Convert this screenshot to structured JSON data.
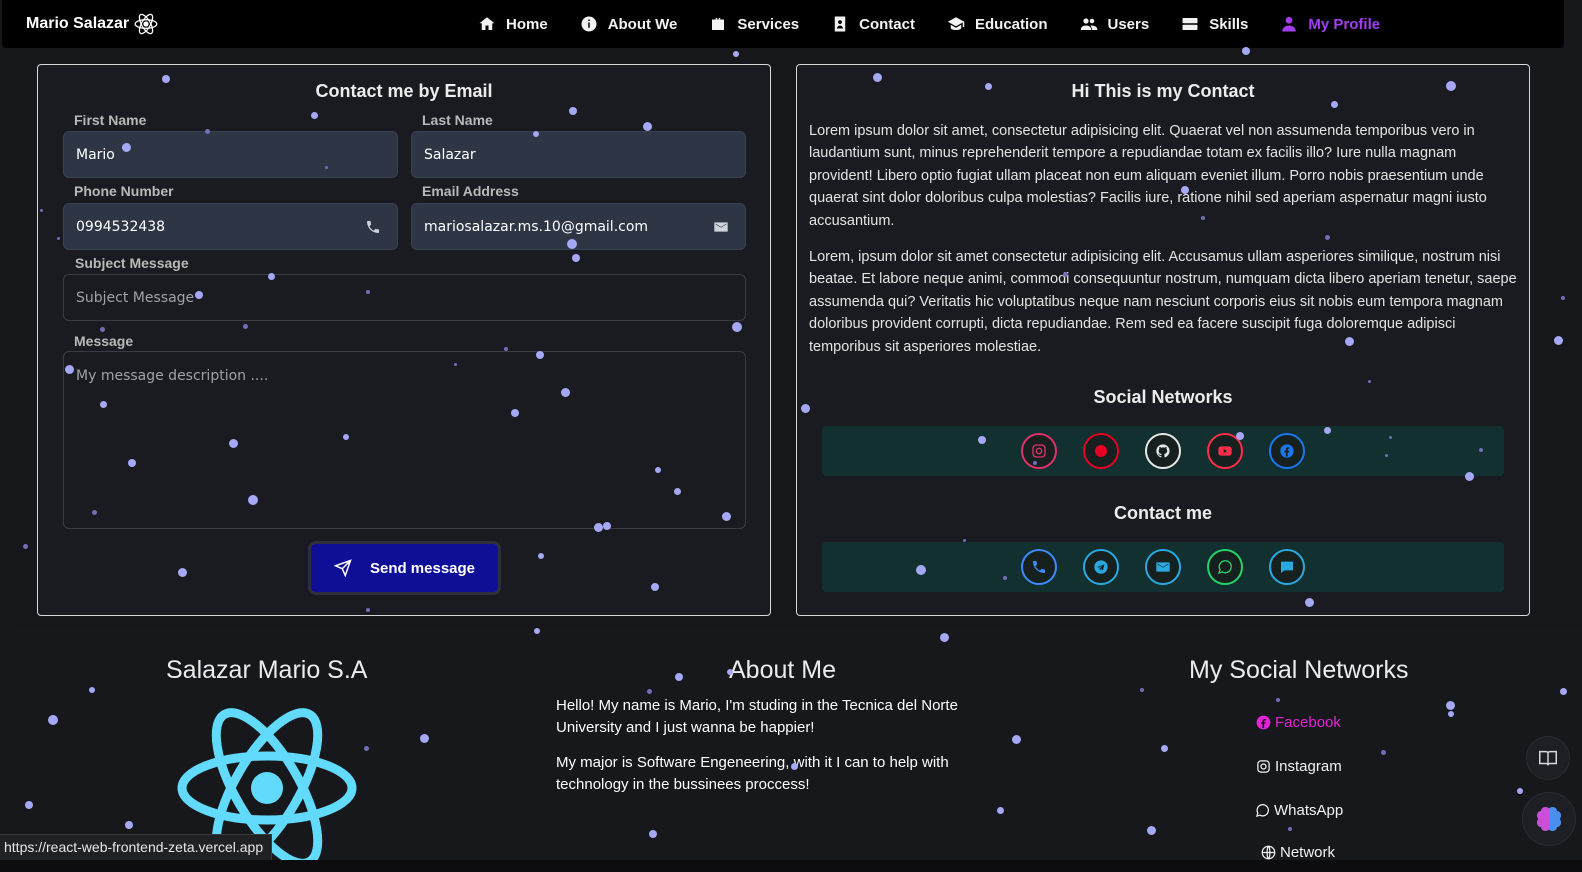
{
  "brand": {
    "name": "Mario Salazar",
    "icon": "react-atom-icon"
  },
  "nav": {
    "items": [
      {
        "label": "Home",
        "icon": "home-icon"
      },
      {
        "label": "About We",
        "icon": "info-icon"
      },
      {
        "label": "Services",
        "icon": "briefcase-icon"
      },
      {
        "label": "Contact",
        "icon": "contact-book-icon"
      },
      {
        "label": "Education",
        "icon": "graduation-cap-icon"
      },
      {
        "label": "Users",
        "icon": "users-icon"
      },
      {
        "label": "Skills",
        "icon": "server-icon"
      },
      {
        "label": "My Profile",
        "icon": "user-icon",
        "active": true
      }
    ],
    "active_color": "#a23ef0"
  },
  "contact_form": {
    "title": "Contact me by Email",
    "first_name": {
      "label": "First Name",
      "value": "Mario"
    },
    "last_name": {
      "label": "Last Name",
      "value": "Salazar"
    },
    "phone": {
      "label": "Phone Number",
      "value": "0994532438"
    },
    "email": {
      "label": "Email Address",
      "value": "mariosalazar.ms.10@gmail.com"
    },
    "subject": {
      "label": "Subject Message",
      "placeholder": "Subject Message"
    },
    "message": {
      "label": "Message",
      "placeholder": "My message description ...."
    },
    "send_label": "Send message"
  },
  "contact_info": {
    "title": "Hi This is my Contact",
    "paragraph1": "Lorem ipsum dolor sit amet, consectetur adipisicing elit. Quaerat vel non assumenda temporibus vero in laudantium sunt, minus reprehenderit tempore a repudiandae totam ex facilis illo? Iure nulla magnam provident! Libero optio fugiat ullam placeat non eum aliquam eveniet illum. Porro nobis praesentium unde quaerat sint dolor doloribus culpa molestias? Facilis iure, ratione nihil sed aperiam aspernatur magni iusto accusantium.",
    "paragraph2": "Lorem, ipsum dolor sit amet consectetur adipisicing elit. Accusamus ullam asperiores similique, nostrum nisi beatae. Et labore neque animi, commodi consequuntur nostrum, numquam dicta libero aperiam tenetur, saepe assumenda qui? Veritatis hic voluptatibus neque nam nesciunt corporis eius sit nobis eum tempora magnam doloribus provident corrupti, dicta repudiandae. Rem sed ea facere suscipit fuga doloremque adipisci temporibus sit asperiores molestiae.",
    "social_title": "Social Networks",
    "social_icons": [
      {
        "icon": "instagram-icon",
        "color": "#e1306c"
      },
      {
        "icon": "pinterest-icon",
        "color": "#e60023"
      },
      {
        "icon": "github-icon",
        "color": "#e8e8e8"
      },
      {
        "icon": "youtube-icon",
        "color": "#ff2d4a"
      },
      {
        "icon": "facebook-icon",
        "color": "#1877f2"
      }
    ],
    "contact_title": "Contact me",
    "contact_icons": [
      {
        "icon": "phone-icon",
        "color": "#3d8bfd"
      },
      {
        "icon": "telegram-icon",
        "color": "#2aa8e0"
      },
      {
        "icon": "email-icon",
        "color": "#2aa8e0"
      },
      {
        "icon": "whatsapp-icon",
        "color": "#25d366"
      },
      {
        "icon": "chat-icon",
        "color": "#2aa8e0"
      }
    ]
  },
  "footer": {
    "company": "Salazar Mario S.A",
    "about_title": "About Me",
    "about_p1": "Hello! My name is Mario, I'm studing in the Tecnica del Norte University and I just wanna be happier!",
    "about_p2": "My major is Software Engeneering, with it I can to help with technology in the bussinees proccess!",
    "social_title": "My Social Networks",
    "links": [
      {
        "label": "Facebook",
        "icon": "facebook-icon"
      },
      {
        "label": "Instagram",
        "icon": "instagram-icon"
      },
      {
        "label": "WhatsApp",
        "icon": "whatsapp-icon"
      },
      {
        "label": "Network",
        "icon": "globe-icon"
      }
    ]
  },
  "status_bar": {
    "url": "https://react-web-frontend-zeta.vercel.app"
  },
  "side_buttons": [
    {
      "icon": "reader-icon"
    },
    {
      "icon": "brain-icon"
    }
  ]
}
